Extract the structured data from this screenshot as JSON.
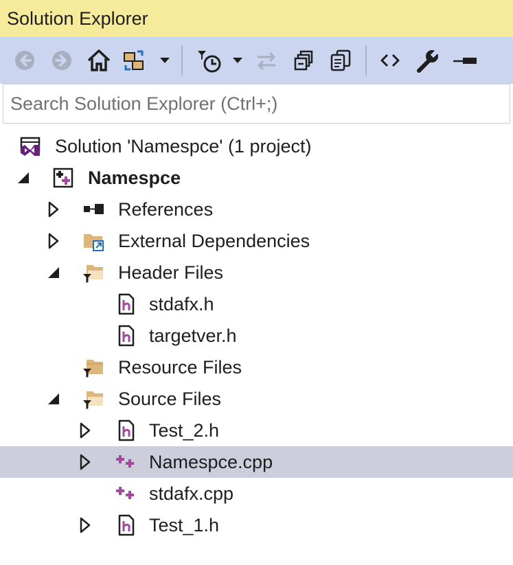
{
  "panel": {
    "title": "Solution Explorer"
  },
  "toolbar": {
    "buttons": [
      {
        "name": "back",
        "icon": "back-arrow-icon",
        "enabled": false
      },
      {
        "name": "forward",
        "icon": "forward-arrow-icon",
        "enabled": false
      },
      {
        "name": "home",
        "icon": "home-icon",
        "enabled": true
      },
      {
        "name": "switch-views",
        "icon": "switch-views-icon",
        "enabled": true,
        "has_dropdown": true
      },
      {
        "name": "pending-changes-filter",
        "icon": "clock-filter-icon",
        "enabled": true,
        "has_dropdown": true
      },
      {
        "name": "sync-with-active-document",
        "icon": "sync-icon",
        "enabled": false
      },
      {
        "name": "collapse-all",
        "icon": "collapse-all-icon",
        "enabled": true
      },
      {
        "name": "show-all-files",
        "icon": "show-all-files-icon",
        "enabled": true
      },
      {
        "name": "view-code",
        "icon": "code-brackets-icon",
        "enabled": true
      },
      {
        "name": "properties",
        "icon": "wrench-icon",
        "enabled": true
      },
      {
        "name": "preview-selected-items",
        "icon": "preview-icon",
        "enabled": true
      }
    ]
  },
  "search": {
    "placeholder": "Search Solution Explorer (Ctrl+;)",
    "value": ""
  },
  "tree": {
    "items": [
      {
        "label": "Solution 'Namespce' (1 project)",
        "icon": "solution-icon",
        "level": 0,
        "expander": "none",
        "bold": false,
        "selected": false
      },
      {
        "label": "Namespce",
        "icon": "cpp-project-icon",
        "level": 1,
        "expander": "expanded",
        "bold": true,
        "selected": false
      },
      {
        "label": "References",
        "icon": "references-icon",
        "level": 2,
        "expander": "collapsed",
        "bold": false,
        "selected": false
      },
      {
        "label": "External Dependencies",
        "icon": "external-dependencies-icon",
        "level": 2,
        "expander": "collapsed",
        "bold": false,
        "selected": false
      },
      {
        "label": "Header Files",
        "icon": "filter-folder-open-icon",
        "level": 2,
        "expander": "expanded",
        "bold": false,
        "selected": false
      },
      {
        "label": "stdafx.h",
        "icon": "header-file-icon",
        "level": 3,
        "expander": "none",
        "bold": false,
        "selected": false
      },
      {
        "label": "targetver.h",
        "icon": "header-file-icon",
        "level": 3,
        "expander": "none",
        "bold": false,
        "selected": false
      },
      {
        "label": "Resource Files",
        "icon": "filter-folder-icon",
        "level": 2,
        "expander": "none",
        "bold": false,
        "selected": false
      },
      {
        "label": "Source Files",
        "icon": "filter-folder-open-icon",
        "level": 2,
        "expander": "expanded",
        "bold": false,
        "selected": false
      },
      {
        "label": "Test_2.h",
        "icon": "header-file-icon",
        "level": 3,
        "expander": "collapsed",
        "bold": false,
        "selected": false
      },
      {
        "label": "Namespce.cpp",
        "icon": "cpp-file-icon",
        "level": 3,
        "expander": "collapsed",
        "bold": false,
        "selected": true
      },
      {
        "label": "stdafx.cpp",
        "icon": "cpp-file-icon",
        "level": 3,
        "expander": "none",
        "bold": false,
        "selected": false
      },
      {
        "label": "Test_1.h",
        "icon": "header-file-icon",
        "level": 3,
        "expander": "collapsed",
        "bold": false,
        "selected": false
      }
    ]
  },
  "colors": {
    "title_bar": "#f5eb9b",
    "toolbar": "#ccd5f0",
    "selection": "#cccedb",
    "vs_purple": "#68217a",
    "cpp_purple": "#a4479e",
    "folder": "#dcb67a"
  }
}
